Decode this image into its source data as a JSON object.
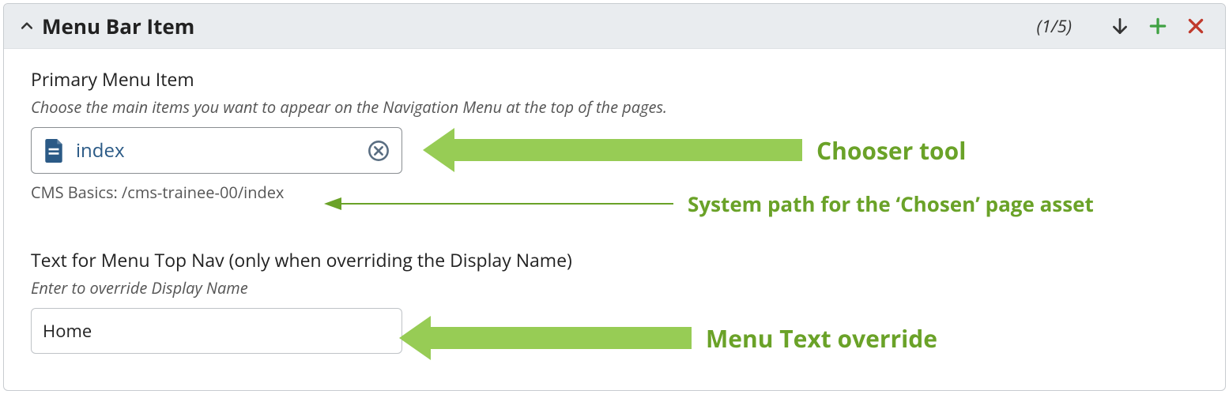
{
  "header": {
    "title": "Menu Bar Item",
    "count": "(1/5)"
  },
  "primary": {
    "label": "Primary Menu Item",
    "help": "Choose the main items you want to appear on the Navigation Menu at the top of the pages.",
    "chosen_name": "index",
    "path": "CMS Basics: /cms-trainee-00/index"
  },
  "override": {
    "label": "Text for Menu Top Nav (only when overriding the Display Name)",
    "help": "Enter to override Display Name",
    "value": "Home"
  },
  "annotations": {
    "chooser": "Chooser tool",
    "path": "System path for the ‘Chosen’ page asset",
    "override": "Menu Text override"
  }
}
